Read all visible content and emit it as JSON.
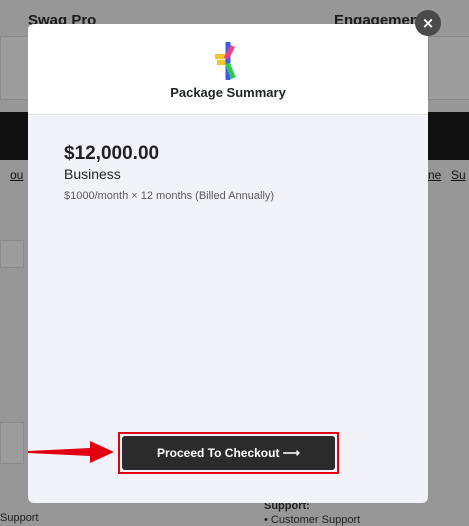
{
  "background": {
    "left_title": "Swag Pro",
    "right_title": "Engagement",
    "left_link": "ou",
    "right_link_1": "ne",
    "right_link_2": "Su",
    "bottom_left_text": "Support",
    "bottom_right_heading": "Support:",
    "bottom_right_item": "• Customer Support"
  },
  "modal": {
    "title": "Package Summary",
    "price": "$12,000.00",
    "plan": "Business",
    "billing": "$1000/month × 12 months (Billed Annually)",
    "checkout_label": "Proceed To Checkout ⟶",
    "close_label": "×"
  },
  "colors": {
    "highlight": "#e0000f",
    "button_bg": "#2b2b2b",
    "logo_yellow": "#f7c52b",
    "logo_pink": "#ef3f8c",
    "logo_blue": "#3b5cf0",
    "logo_green": "#2ccd4a"
  },
  "icons": {
    "logo": "brand-asterisk-logo",
    "arrow": "red-arrow-pointer",
    "close": "close-icon"
  }
}
